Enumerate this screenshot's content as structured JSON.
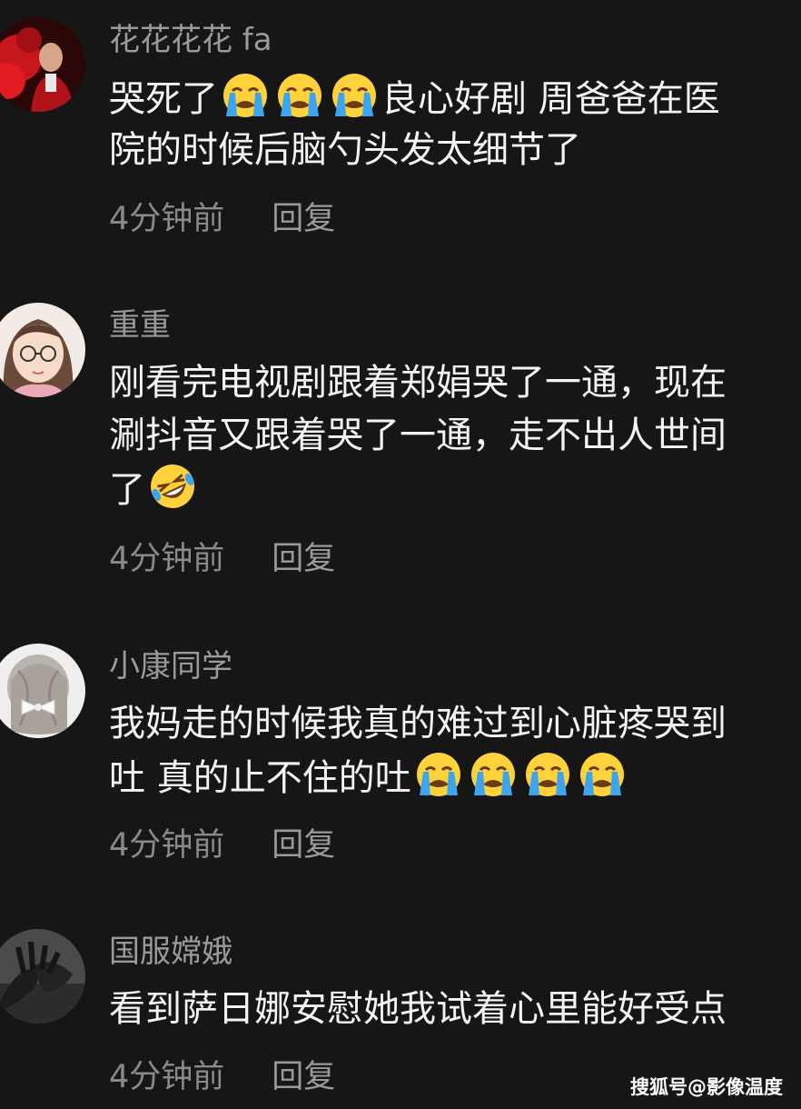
{
  "comments": [
    {
      "username": "花花花花 fa",
      "avatar_icon": "user-avatar-red-photo",
      "lines": [
        {
          "segments": [
            {
              "t": "text",
              "v": "哭死了"
            },
            {
              "t": "emoji",
              "v": "crying-face-emoji"
            },
            {
              "t": "emoji",
              "v": "crying-face-emoji"
            },
            {
              "t": "emoji",
              "v": "crying-face-emoji"
            },
            {
              "t": "text",
              "v": "良心好剧 周爸爸在医"
            }
          ]
        },
        {
          "segments": [
            {
              "t": "text",
              "v": "院的时候后脑勺头发太细节了"
            }
          ]
        }
      ],
      "time": "4分钟前",
      "reply": "回复"
    },
    {
      "username": "重重",
      "avatar_icon": "user-avatar-cartoon-glasses-girl",
      "lines": [
        {
          "segments": [
            {
              "t": "text",
              "v": "刚看完电视剧跟着郑娟哭了一通，现在"
            }
          ]
        },
        {
          "segments": [
            {
              "t": "text",
              "v": "涮抖音又跟着哭了一通，走不出人世间"
            }
          ]
        },
        {
          "segments": [
            {
              "t": "text",
              "v": "了"
            },
            {
              "t": "emoji",
              "v": "rolling-laughing-emoji"
            }
          ]
        }
      ],
      "time": "4分钟前",
      "reply": "回复"
    },
    {
      "username": "小康同学",
      "avatar_icon": "user-avatar-girl-hair-bow",
      "lines": [
        {
          "segments": [
            {
              "t": "text",
              "v": "我妈走的时候我真的难过到心脏疼哭到"
            }
          ]
        },
        {
          "segments": [
            {
              "t": "text",
              "v": "吐 真的止不住的吐"
            },
            {
              "t": "emoji",
              "v": "crying-face-emoji"
            },
            {
              "t": "emoji",
              "v": "crying-face-emoji"
            },
            {
              "t": "emoji",
              "v": "crying-face-emoji"
            },
            {
              "t": "emoji",
              "v": "crying-face-emoji"
            }
          ]
        }
      ],
      "time": "4分钟前",
      "reply": "回复"
    },
    {
      "username": "国服嫦娥",
      "avatar_icon": "user-avatar-hands-photo",
      "lines": [
        {
          "segments": [
            {
              "t": "text",
              "v": "看到萨日娜安慰她我试着心里能好受点"
            }
          ]
        }
      ],
      "time": "4分钟前",
      "reply": "回复"
    }
  ],
  "watermark": "搜狐号@影像温度",
  "colors": {
    "background": "#161616",
    "username": "#9a9a9a",
    "text": "#f4f4f4",
    "meta": "#8a8a8a"
  }
}
